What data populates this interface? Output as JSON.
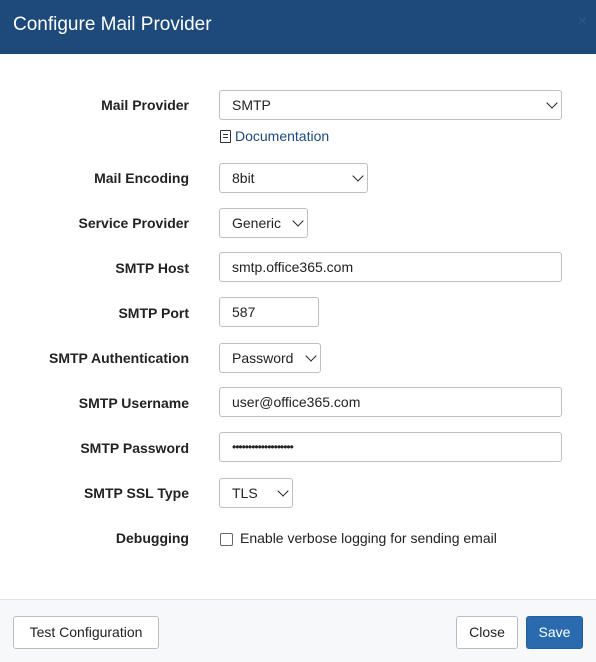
{
  "dialog": {
    "title": "Configure Mail Provider",
    "close_glyph": "×"
  },
  "form": {
    "mail_provider": {
      "label": "Mail Provider",
      "value": "SMTP"
    },
    "documentation_link": "Documentation",
    "mail_encoding": {
      "label": "Mail Encoding",
      "value": "8bit"
    },
    "service_provider": {
      "label": "Service Provider",
      "value": "Generic"
    },
    "smtp_host": {
      "label": "SMTP Host",
      "value": "smtp.office365.com"
    },
    "smtp_port": {
      "label": "SMTP Port",
      "value": "587"
    },
    "smtp_auth": {
      "label": "SMTP Authentication",
      "value": "Password"
    },
    "smtp_username": {
      "label": "SMTP Username",
      "value": "user@office365.com"
    },
    "smtp_password": {
      "label": "SMTP Password",
      "value": "•••••••••••••••••••"
    },
    "smtp_ssl_type": {
      "label": "SMTP SSL Type",
      "value": "TLS"
    },
    "debugging": {
      "label": "Debugging",
      "checkbox_label": "Enable verbose logging for sending email",
      "checked": false
    }
  },
  "footer": {
    "test_label": "Test Configuration",
    "close_label": "Close",
    "save_label": "Save"
  },
  "colors": {
    "header_bg": "#1d4a7a",
    "primary": "#2a6bb0",
    "link": "#1d4a7a"
  },
  "icons": {
    "documentation": "document-icon",
    "dropdown": "chevron-down-icon",
    "close": "close-icon"
  }
}
